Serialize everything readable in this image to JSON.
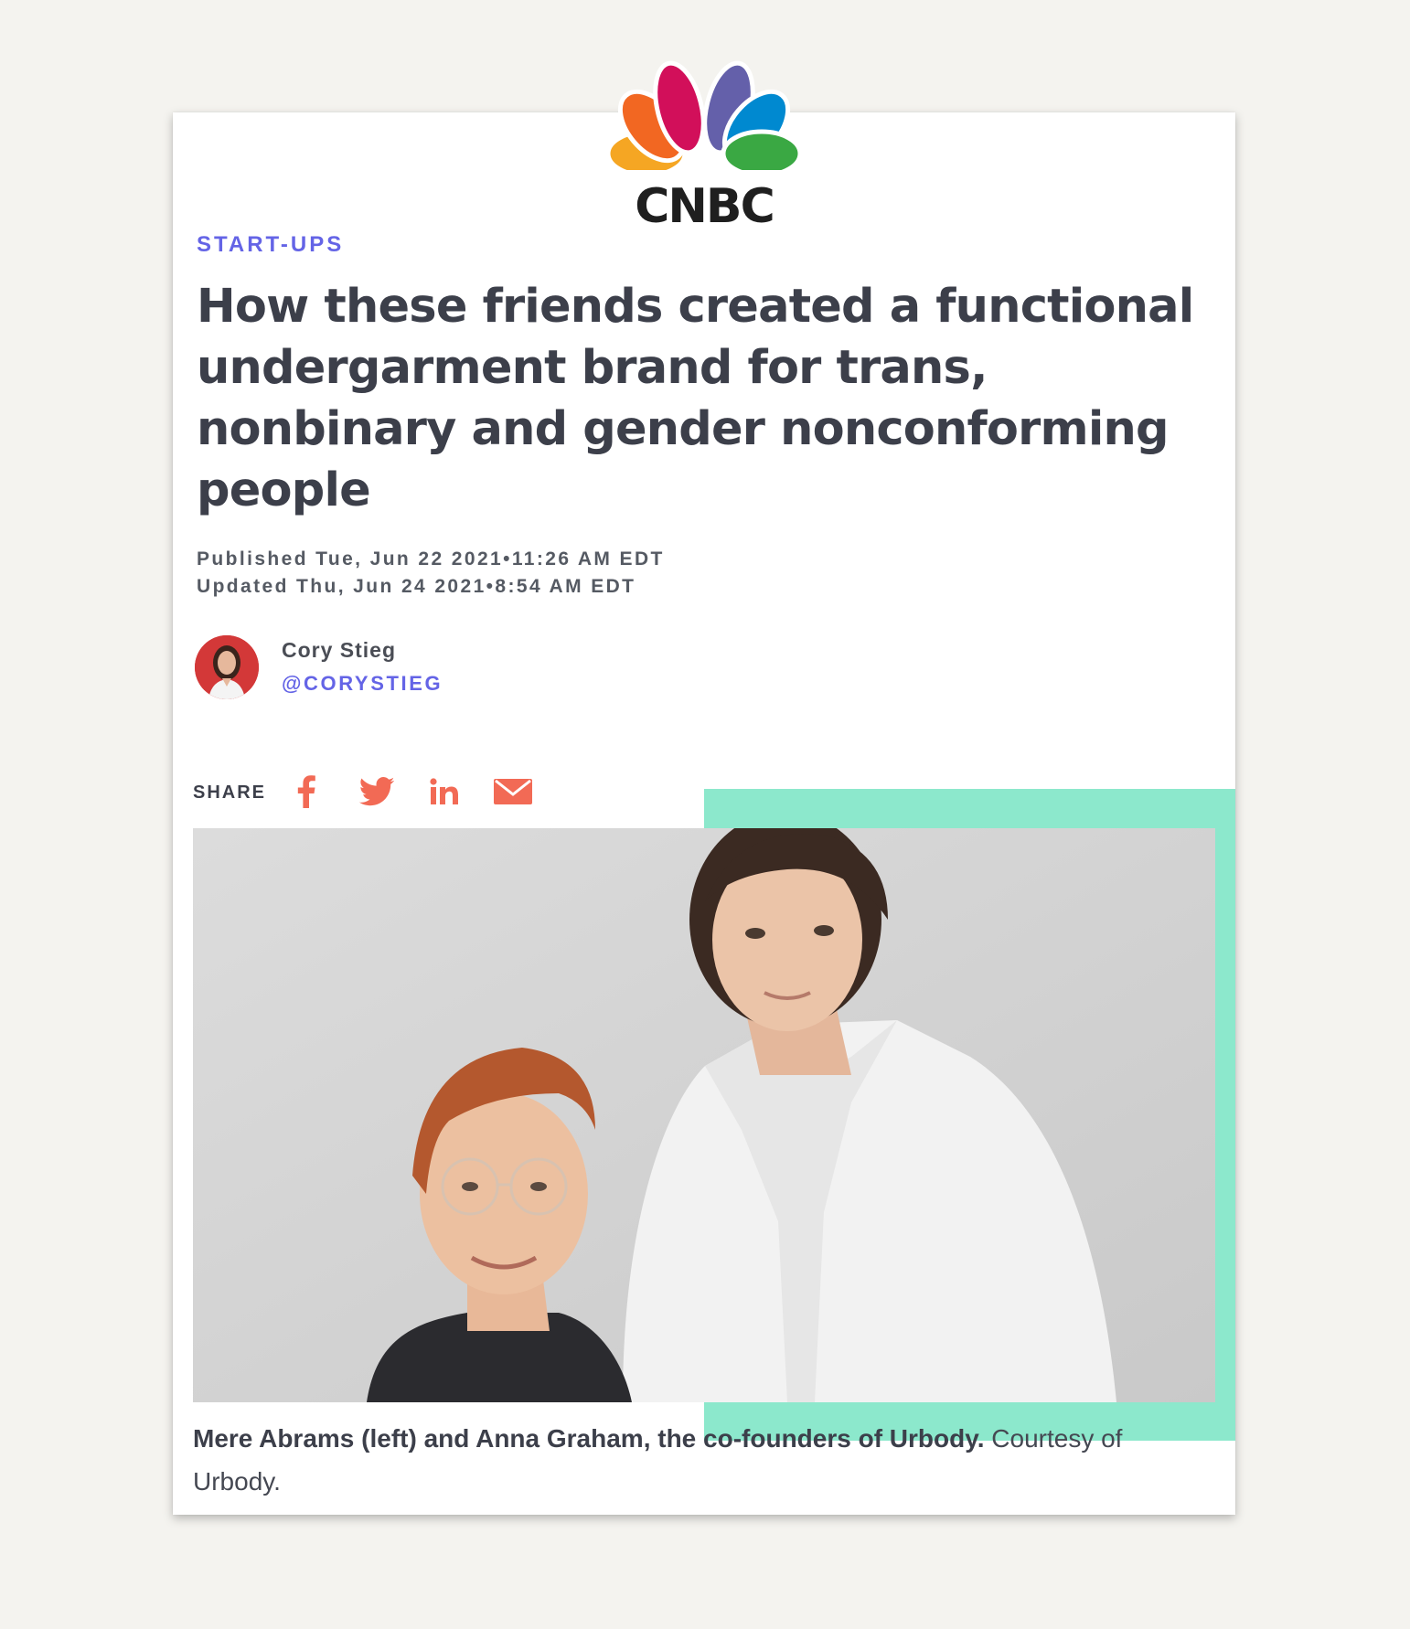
{
  "brand": {
    "logo_text": "CNBC",
    "peacock_colors": [
      "#f5a623",
      "#f26722",
      "#d20f5a",
      "#6460aa",
      "#0089d0",
      "#3aa843"
    ]
  },
  "article": {
    "category": "START-UPS",
    "headline": "How these friends created a functional undergarment brand for trans, nonbinary and gender nonconforming people",
    "published": "Published Tue, Jun 22 2021•11:26 AM EDT",
    "updated": "Updated Thu, Jun 24 2021•8:54 AM EDT"
  },
  "author": {
    "name": "Cory Stieg",
    "handle": "@CORYSTIEG"
  },
  "share": {
    "label": "SHARE",
    "icons": [
      "facebook-icon",
      "twitter-icon",
      "linkedin-icon",
      "email-icon"
    ],
    "icon_color": "#f26a55"
  },
  "image": {
    "caption_bold": "Mere Abrams (left) and Anna Graham, the co-founders of Urbody.",
    "caption_credit": "Courtesy of Urbody."
  },
  "colors": {
    "accent": "#6464e6",
    "headline": "#3c3f4a",
    "frame": "#8ce8cc",
    "background": "#f4f3ef"
  }
}
